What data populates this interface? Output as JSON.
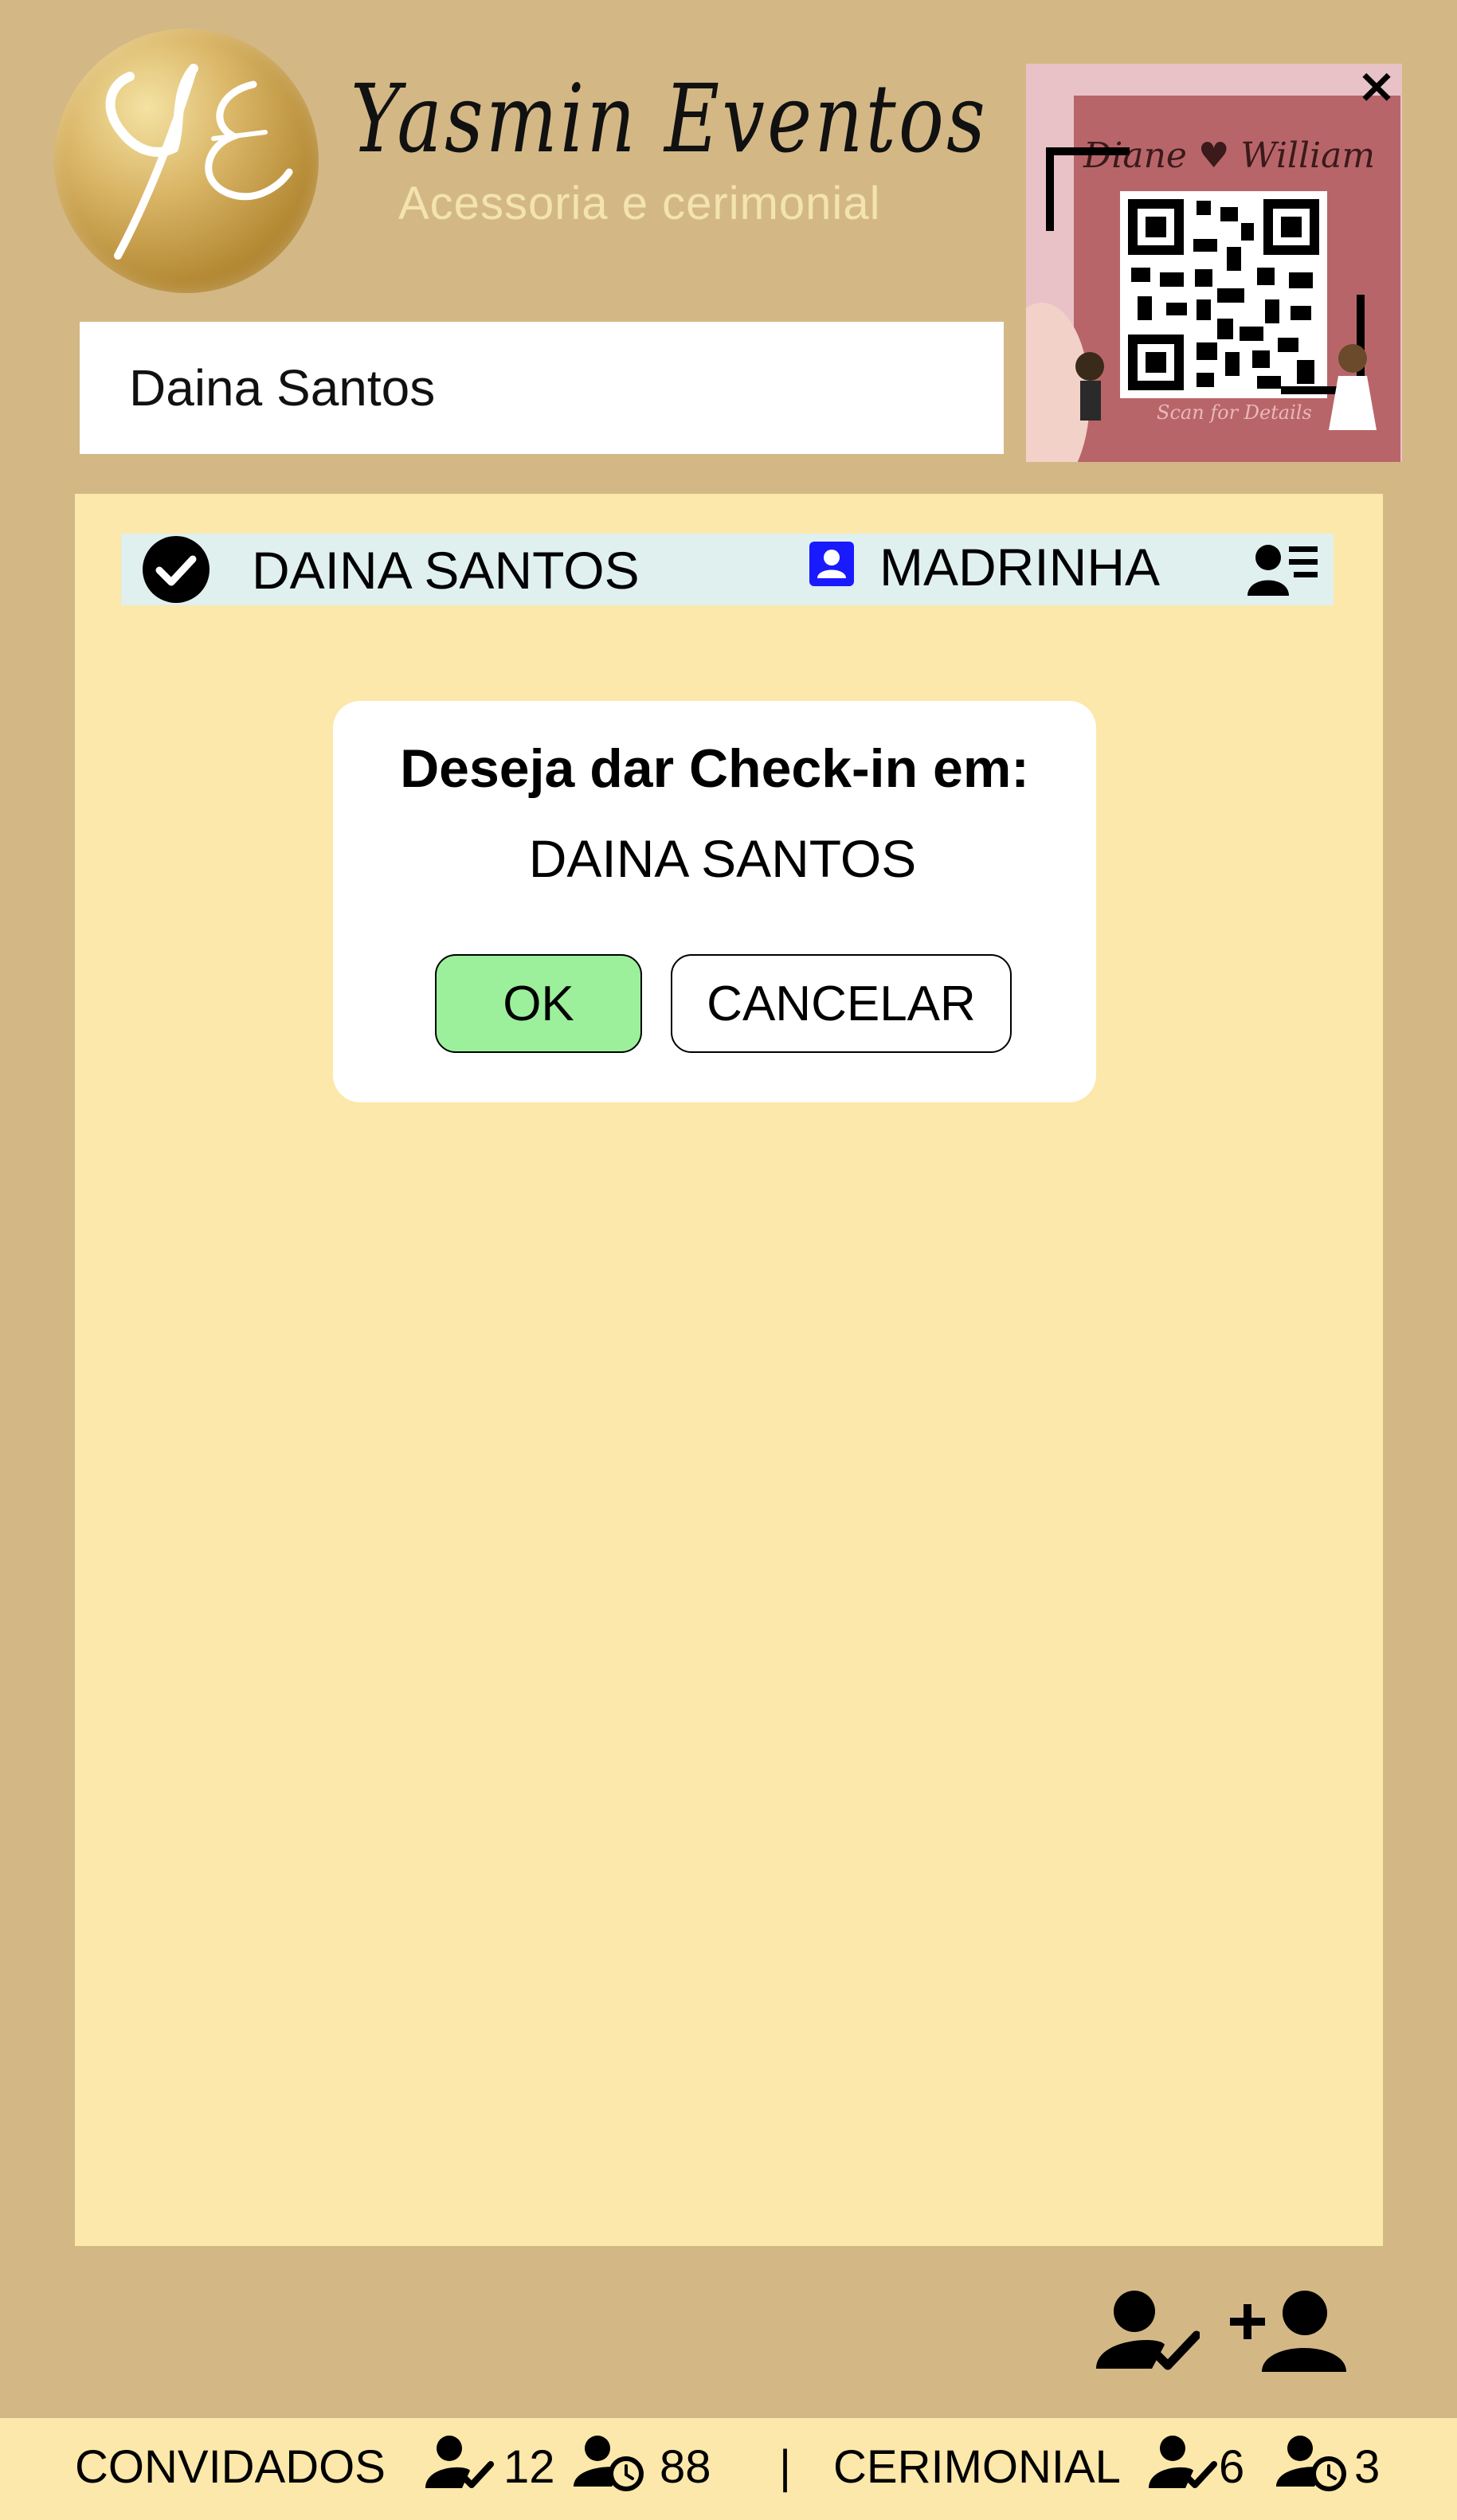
{
  "header": {
    "brand_name": "Yasmin Eventos",
    "brand_subtitle": "Acessoria e cerimonial",
    "logo_monogram": "YE"
  },
  "search": {
    "value": "Daina Santos"
  },
  "qr_preview": {
    "couple": "Diane ♥ William",
    "caption": "Scan for Details",
    "close_label": "×"
  },
  "guest_row": {
    "name": "DAINA SANTOS",
    "role": "MADRINHA",
    "checked_in": true
  },
  "dialog": {
    "title": "Deseja dar Check-in em:",
    "guest_name": "DAINA SANTOS",
    "ok_label": "OK",
    "cancel_label": "CANCELAR"
  },
  "footer": {
    "guests_label": "CONVIDADOS",
    "guests_checked": "12",
    "guests_pending": "88",
    "separator": "|",
    "ceremonial_label": "CERIMONIAL",
    "ceremonial_checked": "6",
    "ceremonial_pending": "3"
  },
  "colors": {
    "frame": "#d3b885",
    "panel": "#fbe8aa",
    "row": "#dff0ef",
    "ok_button": "#9cf09c",
    "role_icon": "#1a1aff"
  }
}
